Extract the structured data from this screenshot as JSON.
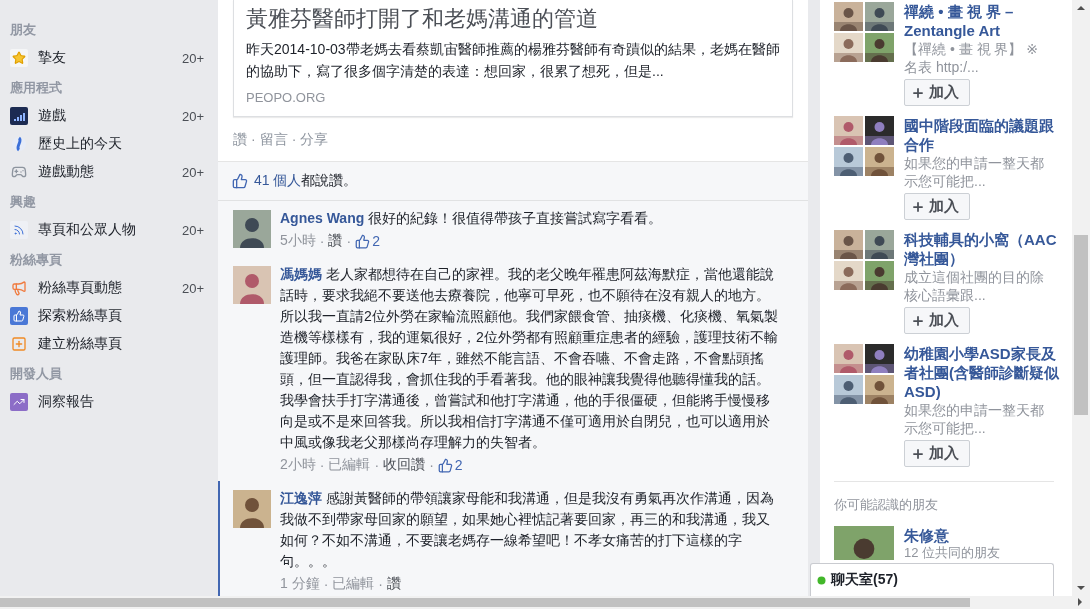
{
  "separator": "·",
  "sidebar": [
    {
      "heading": "朋友",
      "items": [
        {
          "label": "摯友",
          "count": "20+"
        }
      ]
    },
    {
      "heading": "應用程式",
      "items": [
        {
          "label": "遊戲",
          "count": "20+"
        },
        {
          "label": "歷史上的今天"
        },
        {
          "label": "遊戲動態",
          "count": "20+"
        }
      ]
    },
    {
      "heading": "興趣",
      "items": [
        {
          "label": "專頁和公眾人物",
          "count": "20+"
        }
      ]
    },
    {
      "heading": "粉絲專頁",
      "items": [
        {
          "label": "粉絲專頁動態",
          "count": "20+"
        },
        {
          "label": "探索粉絲專頁"
        },
        {
          "label": "建立粉絲專頁"
        }
      ]
    },
    {
      "heading": "開發人員",
      "items": [
        {
          "label": "洞察報告"
        }
      ]
    }
  ],
  "post": {
    "link_card": {
      "title": "黃雅芬醫師打開了和老媽溝通的管道",
      "description": "昨天2014-10-03帶老媽去看蔡凱宙醫師推薦的楊雅芬醫師有奇蹟似的結果，老媽在醫師的協助下，寫了很多個字清楚的表達：想回家，很累了想死，但是...",
      "domain": "PEOPO.ORG"
    },
    "actions": [
      "讚",
      "留言",
      "分享"
    ],
    "like_summary": {
      "people": "41 個人",
      "rest": "都說讚。"
    },
    "comments": [
      {
        "author": "Agnes Wang",
        "paragraphs": [
          "很好的紀錄！很值得帶孩子直接嘗試寫字看看。"
        ],
        "highlighted": false,
        "meta": [
          {
            "kind": "time",
            "label": "5小時"
          },
          {
            "kind": "action",
            "label": "讚"
          },
          {
            "kind": "likes",
            "label": "2"
          }
        ]
      },
      {
        "author": "馮媽媽",
        "paragraphs": [
          "老人家都想待在自己的家裡。我的老父晚年罹患阿茲海默症，當他還能說話時，要求我絕不要送他去療養院，他寧可早死，也不願待在沒有親人的地方。所以我一直請2位外勞在家輪流照顧他。我們家餵食管、抽痰機、化痰機、氧氣製造機等樣樣有，我的運氣很好，2位外勞都有照顧重症患者的經驗，護理技術不輸護理師。我爸在家臥床7年，雖然不能言語、不會吞嚥、不會走路，不會點頭搖頭，但一直認得我，會抓住我的手看著我。他的眼神讓我覺得他聽得懂我的話。",
          "我學會扶手打字溝通後，曾嘗試和他打字溝通，他的手很僵硬，但能將手慢慢移向是或不是來回答我。所以我相信打字溝通不僅可適用於自閉兒，也可以適用於中風或像我老父那樣尚存理解力的失智者。"
        ],
        "highlighted": false,
        "meta": [
          {
            "kind": "time",
            "label": "2小時"
          },
          {
            "kind": "time",
            "label": "已編輯"
          },
          {
            "kind": "action",
            "label": "收回讚"
          },
          {
            "kind": "likes",
            "label": "2"
          }
        ]
      },
      {
        "author": "江逸萍",
        "paragraphs": [
          "感謝黃醫師的帶領讓家母能和我溝通，但是我沒有勇氣再次作溝通，因為我做不到帶家母回家的願望，如果她心裡惦記著要回家，再三的和我溝通，我又如何？不如不溝通，不要讓老媽存一線希望吧！不孝女痛苦的打下這樣的字句。。。"
        ],
        "highlighted": true,
        "meta": [
          {
            "kind": "time",
            "label": "1 分鐘"
          },
          {
            "kind": "time",
            "label": "已編輯"
          },
          {
            "kind": "action",
            "label": "讚"
          }
        ]
      }
    ]
  },
  "groups": [
    {
      "title_lines": [
        "禪繞 • 畫 視 界 –",
        "Zentangle Art"
      ],
      "description_lines": [
        "【禪繞 • 畫 視 界】 ※",
        "名表 http:/..."
      ],
      "button": "加入"
    },
    {
      "title_lines": [
        "國中階段面臨的議題跟",
        "合作"
      ],
      "description_lines": [
        "如果您的申請一整天都",
        "示您可能把..."
      ],
      "button": "加入"
    },
    {
      "title_lines": [
        "科技輔具的小窩（AAC",
        "灣社團）"
      ],
      "description_lines": [
        "成立這個社團的目的除",
        "核心語彙跟..."
      ],
      "button": "加入"
    },
    {
      "title_lines": [
        "幼稚園小學ASD家長及",
        "者社團(含醫師診斷疑似",
        "ASD)"
      ],
      "description_lines": [
        "如果您的申請一整天都",
        "示您可能把..."
      ],
      "button": "加入"
    }
  ],
  "people_you_may_know": {
    "heading": "你可能認識的朋友",
    "people": [
      {
        "name": "朱修意",
        "mutual": "12 位共同的朋友"
      }
    ]
  },
  "chat": {
    "label": "聊天室(57)"
  }
}
